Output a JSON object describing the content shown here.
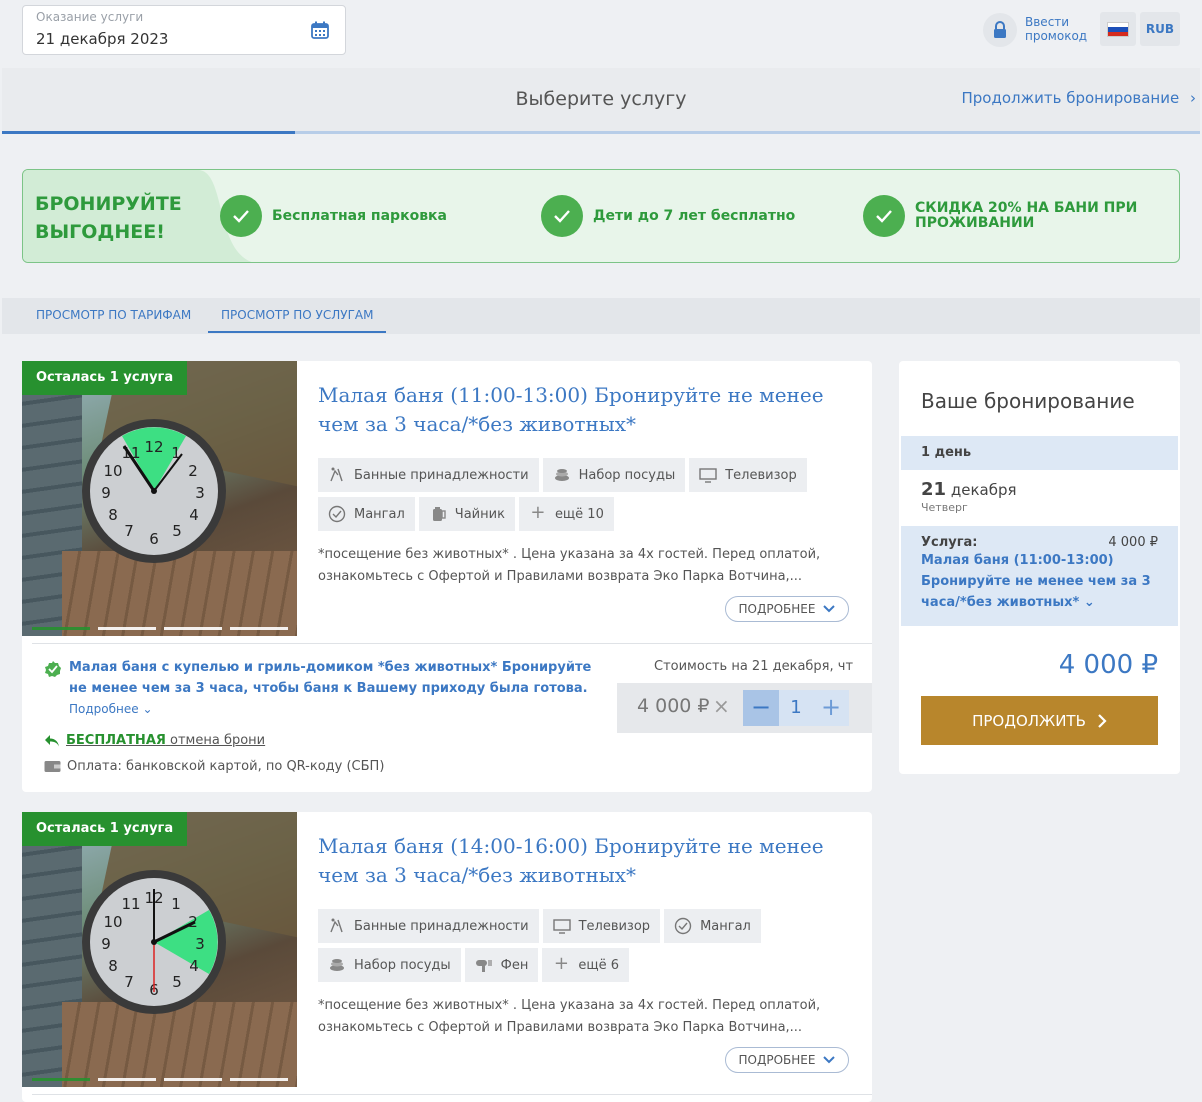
{
  "header": {
    "date_label": "Оказание услуги",
    "date_value": "21 декабря 2023",
    "promo_label": "Ввести промокод",
    "currency": "RUB"
  },
  "steps": {
    "title": "Выберите услугу",
    "continue_link": "Продолжить бронирование"
  },
  "banner": {
    "title": "БРОНИРУЙТЕ ВЫГОДНЕЕ!",
    "perks": [
      "Бесплатная парковка",
      "Дети до 7 лет бесплатно",
      "СКИДКА 20% НА БАНИ ПРИ ПРОЖИВАНИИ"
    ]
  },
  "tabs": [
    {
      "label": "ПРОСМОТР ПО ТАРИФАМ",
      "active": false
    },
    {
      "label": "ПРОСМОТР ПО УСЛУГАМ",
      "active": true
    }
  ],
  "services": [
    {
      "badge": "Осталась 1 услуга",
      "title": "Малая баня (11:00-13:00) Бронируйте не менее чем за 3 часа/*без животных*",
      "amenities": [
        "Банные принадлежности",
        "Набор посуды",
        "Телевизор",
        "Мангал",
        "Чайник",
        "ещё 10"
      ],
      "description": "*посещение без животных* . Цена указана за 4х гостей. Перед оплатой, ознакомьтесь с Офертой и Правилами возврата Эко Парка Вотчина,...",
      "more_label": "ПОДРОБНЕЕ",
      "tariff": {
        "name": "Малая баня с купелью и гриль-домиком *без животных* Бронируйте не менее чем за 3 часа, чтобы баня к Вашему приходу была готова.",
        "more": "Подробнее",
        "cancel_bold": "БЕСПЛАТНАЯ",
        "cancel_rest": "отмена брони",
        "payment": "Оплата: банковской картой, по QR-коду (СБП)",
        "price_label": "Стоимость на 21 декабря, чт",
        "price": "4 000 ₽",
        "times": "×",
        "minus": "−",
        "quantity": "1",
        "plus": "+"
      }
    },
    {
      "badge": "Осталась 1 услуга",
      "title": "Малая баня (14:00-16:00) Бронируйте не менее чем за 3 часа/*без животных*",
      "amenities": [
        "Банные принадлежности",
        "Телевизор",
        "Мангал",
        "Набор посуды",
        "Фен",
        "ещё 6"
      ],
      "description": "*посещение без животных* . Цена указана за 4х гостей. Перед оплатой, ознакомьтесь с Офертой и Правилами возврата Эко Парка Вотчина,...",
      "more_label": "ПОДРОБНЕЕ"
    }
  ],
  "clock_digits": [
    "12",
    "1",
    "2",
    "3",
    "4",
    "5",
    "6",
    "7",
    "8",
    "9",
    "10",
    "11"
  ],
  "summary": {
    "title": "Ваше бронирование",
    "days": "1 день",
    "day_num": "21",
    "month": "декабря",
    "weekday": "Четверг",
    "service_label": "Услуга:",
    "service_price": "4 000 ₽",
    "service_name": "Малая баня (11:00-13:00) Бронируйте не менее чем за 3 часа/*без животных*",
    "total": "4 000 ₽",
    "cta": "ПРОДОЛЖИТЬ"
  },
  "colors": {
    "accent": "#3c78c3",
    "green": "#27912f",
    "cta": "#b8862c"
  }
}
